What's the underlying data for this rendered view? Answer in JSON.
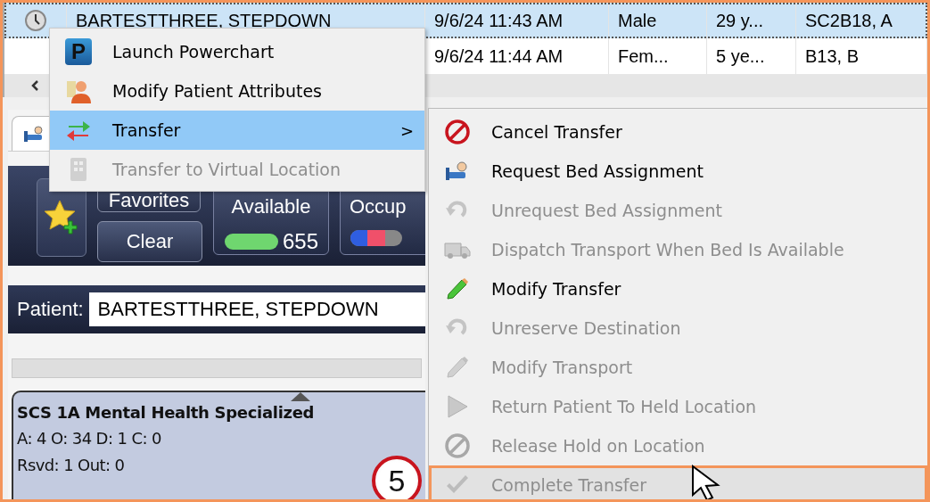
{
  "table": {
    "rows": [
      {
        "selected": true,
        "column_2": "BARTESTTHREE, STEPDOWN",
        "column_3": "9/6/24 11:43 AM",
        "column_4": "Male",
        "column_5": "29 y...",
        "column_6": "SC2B18, A"
      },
      {
        "selected": false,
        "column_3": "9/6/24 11:44 AM",
        "column_4": "Fem...",
        "column_5": "5 ye...",
        "column_6": "B13, B"
      }
    ]
  },
  "toolbar": {
    "favorites": "Favorites",
    "clear": "Clear",
    "stats": [
      {
        "kind": "available",
        "label": "Available",
        "count": "655"
      },
      {
        "kind": "occupied",
        "label": "Occup"
      }
    ]
  },
  "patient": {
    "label": "Patient:",
    "value": "BARTESTTHREE, STEPDOWN"
  },
  "unit": {
    "title": "SCS 1A Mental Health Specialized",
    "lines": [
      "A: 4 O: 34 D: 1 C: 0",
      "Rsvd: 1 Out: 0"
    ]
  },
  "context_menu": {
    "items": [
      {
        "label": "Launch Powerchart",
        "icon_letter": "P",
        "selected": false,
        "disabled": false
      },
      {
        "label": "Modify Patient Attributes",
        "selected": false,
        "disabled": false
      },
      {
        "label": "Transfer",
        "selected": true,
        "disabled": false,
        "submenu_arrow": ">"
      },
      {
        "label": "Transfer to Virtual Location",
        "selected": false,
        "disabled": true
      }
    ]
  },
  "submenu": {
    "items": [
      {
        "label": "Cancel Transfer",
        "disabled": false,
        "selected": false
      },
      {
        "label": "Request Bed Assignment",
        "disabled": false,
        "selected": false
      },
      {
        "label": "Unrequest Bed Assignment",
        "disabled": true,
        "selected": false
      },
      {
        "label": "Dispatch Transport When Bed Is Available",
        "disabled": true,
        "selected": false
      },
      {
        "label": "Modify Transfer",
        "disabled": false,
        "selected": false
      },
      {
        "label": "Unreserve Destination",
        "disabled": true,
        "selected": false
      },
      {
        "label": "Modify Transport",
        "disabled": true,
        "selected": false
      },
      {
        "label": "Return Patient To Held Location",
        "disabled": true,
        "selected": false
      },
      {
        "label": "Release Hold on Location",
        "disabled": true,
        "selected": false
      },
      {
        "label": "Complete Transfer",
        "disabled": true,
        "selected": true
      }
    ]
  },
  "callout": {
    "number": "5"
  }
}
